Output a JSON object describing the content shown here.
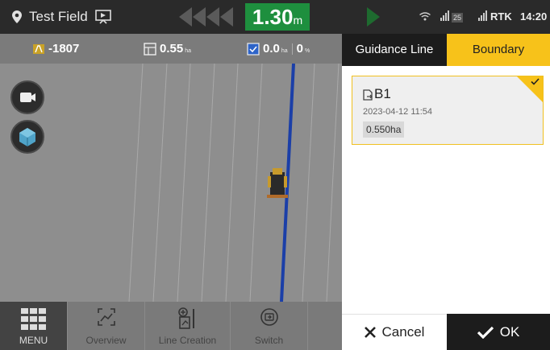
{
  "topbar": {
    "field_name": "Test Field",
    "offset_value": "1.30",
    "offset_unit": "m",
    "satellites": "25",
    "rtk_label": "RTK",
    "time": "14:20"
  },
  "info_strip": {
    "heading_value": "-1807",
    "area_value": "0.55",
    "area_unit": "ha",
    "worked_value": "0.0",
    "worked_unit": "ha",
    "percent_value": "0",
    "percent_unit": "%"
  },
  "bottom_bar": {
    "menu_label": "MENU",
    "items": [
      {
        "label": "Overview"
      },
      {
        "label": "Line Creation"
      },
      {
        "label": "Switch"
      }
    ]
  },
  "panel": {
    "tabs": [
      {
        "label": "Guidance Line",
        "active": false
      },
      {
        "label": "Boundary",
        "active": true
      }
    ],
    "boundary_card": {
      "name": "B1",
      "date": "2023-04-12 11:54",
      "area": "0.550ha",
      "selected": true
    },
    "cancel_label": "Cancel",
    "ok_label": "OK"
  },
  "colors": {
    "accent": "#f7c21a",
    "offset_green": "#1e8f3e",
    "guidance_line": "#1b3fa8"
  }
}
